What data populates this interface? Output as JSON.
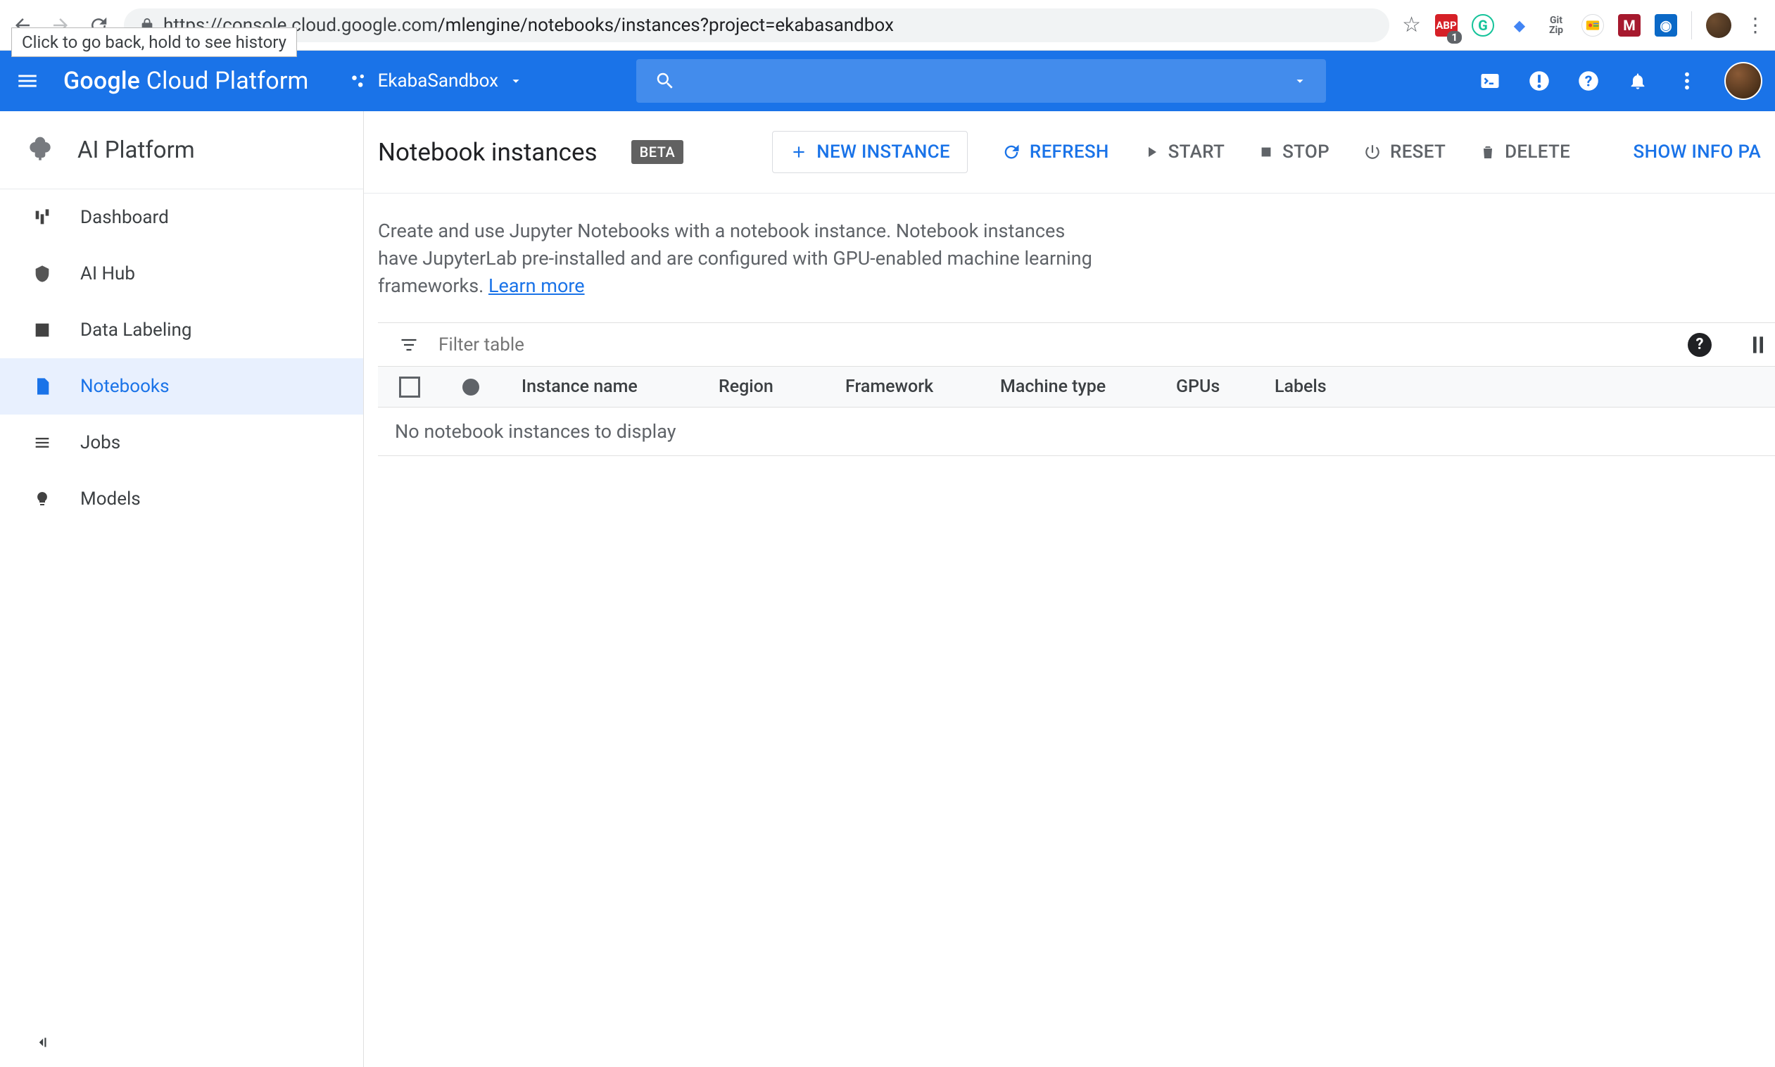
{
  "browser": {
    "tooltip": "Click to go back, hold to see history",
    "url_host": "https://console.cloud.google.com",
    "url_path": "/mlengine/notebooks/instances?project=ekabasandbox",
    "ext_badge_abp": "ABP",
    "ext_badge_abp_count": "1",
    "ext_gitzip": "Git Zip"
  },
  "gcp": {
    "logo_1": "Google",
    "logo_2": "Cloud Platform",
    "project": "EkabaSandbox",
    "search_placeholder": ""
  },
  "sidebar": {
    "title": "AI Platform",
    "items": [
      {
        "label": "Dashboard"
      },
      {
        "label": "AI Hub"
      },
      {
        "label": "Data Labeling"
      },
      {
        "label": "Notebooks"
      },
      {
        "label": "Jobs"
      },
      {
        "label": "Models"
      }
    ]
  },
  "page": {
    "title": "Notebook instances",
    "badge": "BETA",
    "actions": {
      "new": "NEW INSTANCE",
      "refresh": "REFRESH",
      "start": "START",
      "stop": "STOP",
      "reset": "RESET",
      "delete": "DELETE",
      "info": "SHOW INFO PA"
    },
    "desc_1": "Create and use Jupyter Notebooks with a notebook instance. Notebook instances have JupyterLab pre-installed and are configured with GPU-enabled machine learning frameworks. ",
    "learn_more": "Learn more"
  },
  "table": {
    "filter_placeholder": "Filter table",
    "columns": {
      "name": "Instance name",
      "region": "Region",
      "framework": "Framework",
      "machine": "Machine type",
      "gpus": "GPUs",
      "labels": "Labels"
    },
    "empty": "No notebook instances to display"
  }
}
